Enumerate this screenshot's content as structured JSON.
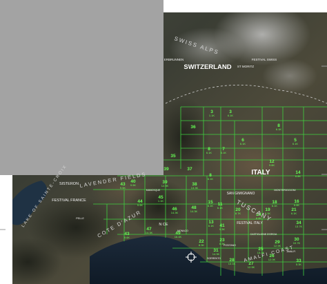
{
  "map": {
    "labels": {
      "switzerland": "SWITZERLAND",
      "italy": "ITALY",
      "swiss_alps": "SWISS ALPS",
      "tuscany": "TUSCANY",
      "lavender_fields": "LAVENDER FIELDS",
      "cote_dazur": "COTE D'AZUR",
      "lake_sainte_croix": "LAKE OF SAINTE-CROIX",
      "amalfi_coast": "AMALFI COAST",
      "erbrunnen": "ERBRUNNEN",
      "st_moritz": "ST MORITZ",
      "festival_swiss": "FESTIVAL SWISS",
      "sisteron": "SISTERON",
      "festival_france": "FESTIVAL FRANCE",
      "nice": "N CE",
      "san_gimignano": "SAN GIMIGNANO",
      "festival_italy": "FESTIVAL ITALY",
      "monteriggioni": "MONTERIGGIONI",
      "castiglione": "CASTIGLIONE D'ORCIA",
      "positano": "POSITANO",
      "amalfi": "AMALFI",
      "sorrento": "SORRENTO",
      "pelle": "PELLE",
      "manosque": "MANOSQUE",
      "monaco": "MONACO"
    },
    "cells": [
      {
        "num": "36",
        "sub": "",
        "color": "#66ff55"
      },
      {
        "num": "3",
        "sub": "1.1K"
      },
      {
        "num": "3",
        "sub": "6.1K"
      },
      {
        "num": "6",
        "sub": "6.1K"
      },
      {
        "num": "5",
        "sub": "6.1K"
      },
      {
        "num": "8",
        "sub": "6.1K"
      },
      {
        "num": "8",
        "sub": "6.1K"
      },
      {
        "num": "7",
        "sub": "6.1K"
      },
      {
        "num": "35",
        "sub": ""
      },
      {
        "num": "39",
        "sub": ""
      },
      {
        "num": "37",
        "sub": ""
      },
      {
        "num": "8",
        "sub": "6.1K"
      },
      {
        "num": "12",
        "sub": "9.6K"
      },
      {
        "num": "14",
        "sub": "6.8K"
      },
      {
        "num": "43",
        "sub": "9.5K"
      },
      {
        "num": "40",
        "sub": "9.5K"
      },
      {
        "num": "39",
        "sub": "12.9K"
      },
      {
        "num": "38",
        "sub": "13.3K"
      },
      {
        "num": "44",
        "sub": "9.9K"
      },
      {
        "num": "45",
        "sub": "1.1K"
      },
      {
        "num": "15",
        "sub": "6.1K"
      },
      {
        "num": "11",
        "sub": "6.1K"
      },
      {
        "num": "18",
        "sub": "6.1K"
      },
      {
        "num": "16",
        "sub": "6.6K"
      },
      {
        "num": "46",
        "sub": "14.3K"
      },
      {
        "num": "48",
        "sub": "14.3K"
      },
      {
        "num": "13",
        "sub": "6.1K"
      },
      {
        "num": "20",
        "sub": "8.7K"
      },
      {
        "num": "19",
        "sub": "6.1K"
      },
      {
        "num": "21",
        "sub": "6.1K"
      },
      {
        "num": "24",
        "sub": "8.8K"
      },
      {
        "num": "34",
        "sub": "13.7K"
      },
      {
        "num": "47",
        "sub": "14.3K"
      },
      {
        "num": "43",
        "sub": "9.6K"
      },
      {
        "num": "41",
        "sub": "9.3K"
      },
      {
        "num": "49",
        "sub": "16.4K"
      },
      {
        "num": "22",
        "sub": "8.3K"
      },
      {
        "num": "23",
        "sub": "6.3K"
      },
      {
        "num": "31",
        "sub": "14.3K"
      },
      {
        "num": "28",
        "sub": "13.1K"
      },
      {
        "num": "27",
        "sub": "12.9K"
      },
      {
        "num": "26",
        "sub": "12.0K"
      },
      {
        "num": "25",
        "sub": "13.3K"
      },
      {
        "num": "29",
        "sub": "12.9K"
      },
      {
        "num": "30",
        "sub": "10.7K"
      },
      {
        "num": "33",
        "sub": "5.3K"
      }
    ],
    "colors": {
      "grid": "#3fd23f",
      "text_grid": "#66ff55",
      "panel": "#a3a3a3"
    },
    "icons": {
      "location_marker": "target-reticle-icon"
    }
  }
}
